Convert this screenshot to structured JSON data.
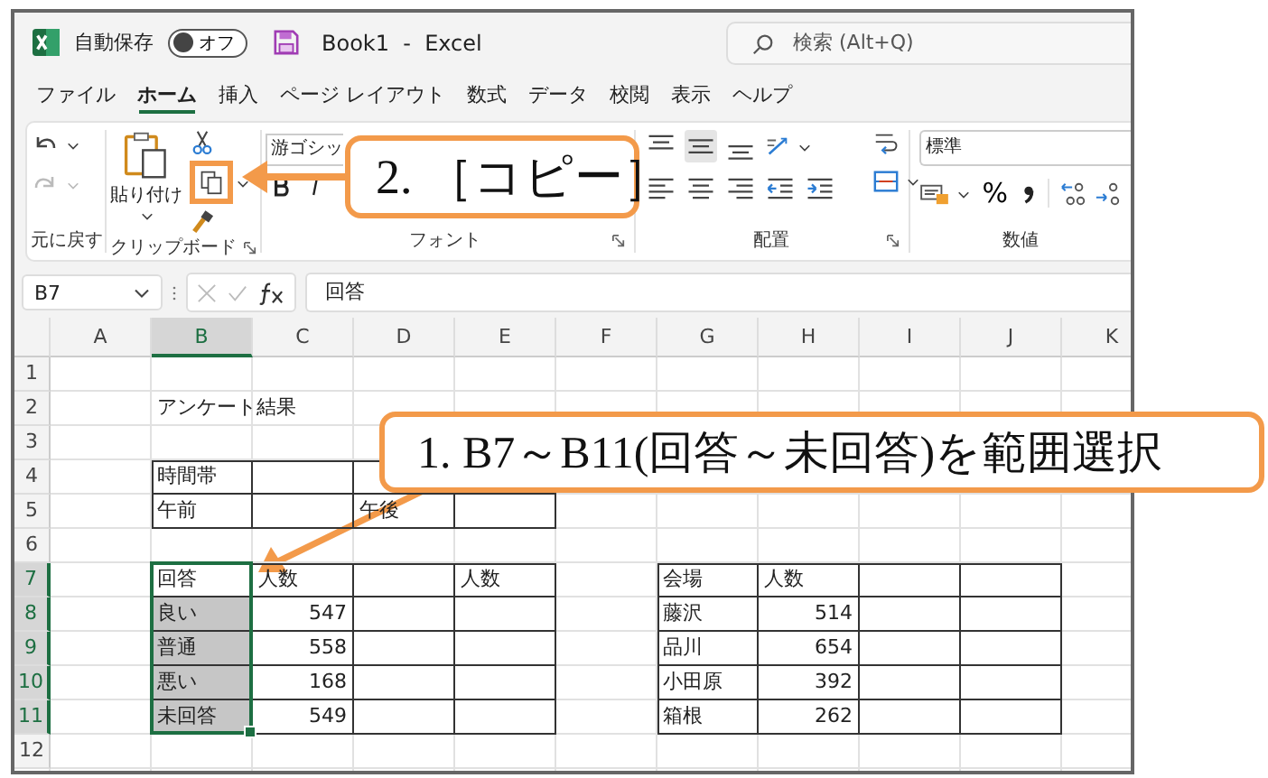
{
  "window": {
    "title": "Book1  -  Excel"
  },
  "autosave": {
    "label": "自動保存",
    "on": false,
    "state_text": "オフ"
  },
  "search": {
    "placeholder": "検索 (Alt+Q)"
  },
  "tabs": [
    {
      "label": "ファイル",
      "selected": false
    },
    {
      "label": "ホーム",
      "selected": true
    },
    {
      "label": "挿入",
      "selected": false
    },
    {
      "label": "ページ レイアウト",
      "selected": false
    },
    {
      "label": "数式",
      "selected": false
    },
    {
      "label": "データ",
      "selected": false
    },
    {
      "label": "校閲",
      "selected": false
    },
    {
      "label": "表示",
      "selected": false
    },
    {
      "label": "ヘルプ",
      "selected": false
    }
  ],
  "ribbon": {
    "undo_group": {
      "label": "元に戻す",
      "redo_disabled": true
    },
    "clipboard_group": {
      "label": "クリップボード",
      "paste_label": "貼り付け",
      "copy_highlighted": true
    },
    "font_group": {
      "label": "フォント",
      "font_name": "游ゴシッ"
    },
    "alignment_group": {
      "label": "配置",
      "top_row": [
        {
          "kind": "align-top",
          "selected": false
        },
        {
          "kind": "align-middle",
          "selected": true
        },
        {
          "kind": "align-bottom",
          "selected": false
        }
      ],
      "bottom_row": [
        {
          "kind": "align-left",
          "selected": false
        },
        {
          "kind": "align-center",
          "selected": false
        },
        {
          "kind": "align-right",
          "selected": false
        },
        {
          "kind": "indent-decrease",
          "selected": false
        },
        {
          "kind": "indent-increase",
          "selected": false
        }
      ]
    },
    "number_group": {
      "label": "数値",
      "format": "標準",
      "percent": "%"
    }
  },
  "formula_bar": {
    "name_box": "B7",
    "value": "回答"
  },
  "sheet": {
    "columns": [
      {
        "label": "A",
        "selected": false
      },
      {
        "label": "B",
        "selected": true
      },
      {
        "label": "C",
        "selected": false
      },
      {
        "label": "D",
        "selected": false
      },
      {
        "label": "E",
        "selected": false
      },
      {
        "label": "F",
        "selected": false
      },
      {
        "label": "G",
        "selected": false
      },
      {
        "label": "H",
        "selected": false
      },
      {
        "label": "I",
        "selected": false
      },
      {
        "label": "J",
        "selected": false
      },
      {
        "label": "K",
        "selected": false
      }
    ],
    "rows": [
      {
        "header": "1",
        "selected": false,
        "cells": [
          {
            "kind": "blank"
          },
          {
            "kind": "blank"
          },
          {
            "kind": "blank"
          },
          {
            "kind": "blank"
          },
          {
            "kind": "blank"
          },
          {
            "kind": "blank"
          },
          {
            "kind": "blank"
          },
          {
            "kind": "blank"
          },
          {
            "kind": "blank"
          },
          {
            "kind": "blank"
          },
          {
            "kind": "blank"
          }
        ]
      },
      {
        "header": "2",
        "selected": false,
        "cells": [
          {
            "kind": "blank"
          },
          {
            "kind": "text",
            "text": "アンケート結果",
            "bordered": false
          },
          {
            "kind": "blank"
          },
          {
            "kind": "blank"
          },
          {
            "kind": "blank"
          },
          {
            "kind": "blank"
          },
          {
            "kind": "blank"
          },
          {
            "kind": "blank"
          },
          {
            "kind": "blank"
          },
          {
            "kind": "blank"
          },
          {
            "kind": "blank"
          }
        ]
      },
      {
        "header": "3",
        "selected": false,
        "cells": [
          {
            "kind": "blank"
          },
          {
            "kind": "blank"
          },
          {
            "kind": "blank"
          },
          {
            "kind": "blank"
          },
          {
            "kind": "blank"
          },
          {
            "kind": "blank"
          },
          {
            "kind": "blank"
          },
          {
            "kind": "blank"
          },
          {
            "kind": "blank"
          },
          {
            "kind": "blank"
          },
          {
            "kind": "blank"
          }
        ]
      },
      {
        "header": "4",
        "selected": false,
        "cells": [
          {
            "kind": "blank"
          },
          {
            "kind": "text",
            "text": "時間帯",
            "bordered": true
          },
          {
            "kind": "blank",
            "bordered": true
          },
          {
            "kind": "blank",
            "bordered": true
          },
          {
            "kind": "blank",
            "bordered": true
          },
          {
            "kind": "blank"
          },
          {
            "kind": "blank"
          },
          {
            "kind": "blank"
          },
          {
            "kind": "blank"
          },
          {
            "kind": "blank"
          },
          {
            "kind": "blank"
          }
        ]
      },
      {
        "header": "5",
        "selected": false,
        "cells": [
          {
            "kind": "blank"
          },
          {
            "kind": "text",
            "text": "午前",
            "bordered": true
          },
          {
            "kind": "blank",
            "bordered": true
          },
          {
            "kind": "text",
            "text": "午後",
            "bordered": true
          },
          {
            "kind": "blank",
            "bordered": true
          },
          {
            "kind": "blank"
          },
          {
            "kind": "blank"
          },
          {
            "kind": "blank"
          },
          {
            "kind": "blank"
          },
          {
            "kind": "blank"
          },
          {
            "kind": "blank"
          }
        ]
      },
      {
        "header": "6",
        "selected": false,
        "cells": [
          {
            "kind": "blank"
          },
          {
            "kind": "blank"
          },
          {
            "kind": "blank"
          },
          {
            "kind": "blank"
          },
          {
            "kind": "blank"
          },
          {
            "kind": "blank"
          },
          {
            "kind": "blank"
          },
          {
            "kind": "blank"
          },
          {
            "kind": "blank"
          },
          {
            "kind": "blank"
          },
          {
            "kind": "blank"
          }
        ]
      },
      {
        "header": "7",
        "selected": true,
        "cells": [
          {
            "kind": "blank"
          },
          {
            "kind": "text",
            "text": "回答",
            "bordered": true
          },
          {
            "kind": "text",
            "text": "人数",
            "bordered": true
          },
          {
            "kind": "blank",
            "bordered": true
          },
          {
            "kind": "text",
            "text": "人数",
            "bordered": true
          },
          {
            "kind": "blank"
          },
          {
            "kind": "text",
            "text": "会場",
            "bordered": true
          },
          {
            "kind": "text",
            "text": "人数",
            "bordered": true
          },
          {
            "kind": "blank",
            "bordered": true
          },
          {
            "kind": "blank",
            "bordered": true
          },
          {
            "kind": "blank"
          }
        ]
      },
      {
        "header": "8",
        "selected": true,
        "cells": [
          {
            "kind": "blank"
          },
          {
            "kind": "text",
            "text": "良い",
            "bordered": true
          },
          {
            "kind": "number",
            "text": "547",
            "bordered": true
          },
          {
            "kind": "blank",
            "bordered": true
          },
          {
            "kind": "blank",
            "bordered": true
          },
          {
            "kind": "blank"
          },
          {
            "kind": "text",
            "text": "藤沢",
            "bordered": true
          },
          {
            "kind": "number",
            "text": "514",
            "bordered": true
          },
          {
            "kind": "blank",
            "bordered": true
          },
          {
            "kind": "blank",
            "bordered": true
          },
          {
            "kind": "blank"
          }
        ]
      },
      {
        "header": "9",
        "selected": true,
        "cells": [
          {
            "kind": "blank"
          },
          {
            "kind": "text",
            "text": "普通",
            "bordered": true
          },
          {
            "kind": "number",
            "text": "558",
            "bordered": true
          },
          {
            "kind": "blank",
            "bordered": true
          },
          {
            "kind": "blank",
            "bordered": true
          },
          {
            "kind": "blank"
          },
          {
            "kind": "text",
            "text": "品川",
            "bordered": true
          },
          {
            "kind": "number",
            "text": "654",
            "bordered": true
          },
          {
            "kind": "blank",
            "bordered": true
          },
          {
            "kind": "blank",
            "bordered": true
          },
          {
            "kind": "blank"
          }
        ]
      },
      {
        "header": "10",
        "selected": true,
        "cells": [
          {
            "kind": "blank"
          },
          {
            "kind": "text",
            "text": "悪い",
            "bordered": true
          },
          {
            "kind": "number",
            "text": "168",
            "bordered": true
          },
          {
            "kind": "blank",
            "bordered": true
          },
          {
            "kind": "blank",
            "bordered": true
          },
          {
            "kind": "blank"
          },
          {
            "kind": "text",
            "text": "小田原",
            "bordered": true
          },
          {
            "kind": "number",
            "text": "392",
            "bordered": true
          },
          {
            "kind": "blank",
            "bordered": true
          },
          {
            "kind": "blank",
            "bordered": true
          },
          {
            "kind": "blank"
          }
        ]
      },
      {
        "header": "11",
        "selected": true,
        "cells": [
          {
            "kind": "blank"
          },
          {
            "kind": "text",
            "text": "未回答",
            "bordered": true
          },
          {
            "kind": "number",
            "text": "549",
            "bordered": true
          },
          {
            "kind": "blank",
            "bordered": true
          },
          {
            "kind": "blank",
            "bordered": true
          },
          {
            "kind": "blank"
          },
          {
            "kind": "text",
            "text": "箱根",
            "bordered": true
          },
          {
            "kind": "number",
            "text": "262",
            "bordered": true
          },
          {
            "kind": "blank",
            "bordered": true
          },
          {
            "kind": "blank",
            "bordered": true
          },
          {
            "kind": "blank"
          }
        ]
      },
      {
        "header": "12",
        "selected": false,
        "cells": [
          {
            "kind": "blank"
          },
          {
            "kind": "blank"
          },
          {
            "kind": "blank"
          },
          {
            "kind": "blank"
          },
          {
            "kind": "blank"
          },
          {
            "kind": "blank"
          },
          {
            "kind": "blank"
          },
          {
            "kind": "blank"
          },
          {
            "kind": "blank"
          },
          {
            "kind": "blank"
          },
          {
            "kind": "blank"
          }
        ]
      }
    ]
  },
  "callouts": [
    {
      "kind": "copy",
      "text": "2. ［コピー］"
    },
    {
      "kind": "cells",
      "text": "1. B7～B11(回答～未回答)を範囲選択"
    }
  ]
}
